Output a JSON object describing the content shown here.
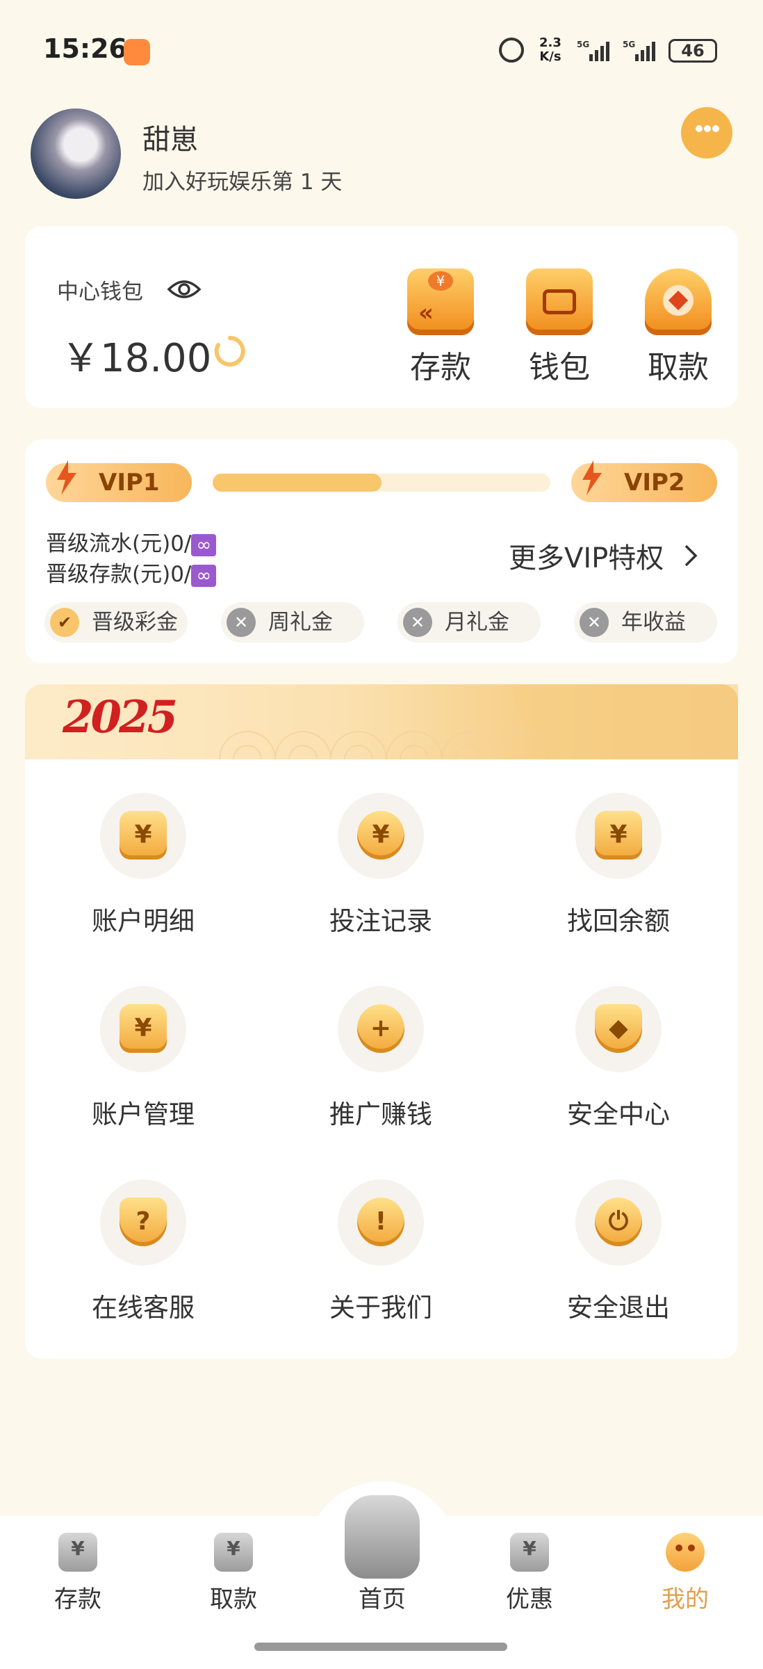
{
  "status_bar": {
    "time": "15:26",
    "net_speed": "2.3\nK/s",
    "battery": "46"
  },
  "profile": {
    "username": "甜崽",
    "join_text": "加入好玩娱乐第 1 天"
  },
  "wallet": {
    "label": "中心钱包",
    "balance": "￥18.00",
    "actions": [
      {
        "label": "存款"
      },
      {
        "label": "钱包"
      },
      {
        "label": "取款"
      }
    ]
  },
  "vip": {
    "current": "VIP1",
    "next": "VIP2",
    "progress": 0.5,
    "flow_req": "晋级流水(元)0/",
    "deposit_req": "晋级存款(元)0/",
    "infinity": "∞",
    "more_link": "更多VIP特权",
    "privileges": [
      {
        "label": "晋级彩金",
        "enabled": true
      },
      {
        "label": "周礼金",
        "enabled": false
      },
      {
        "label": "月礼金",
        "enabled": false
      },
      {
        "label": "年收益",
        "enabled": false
      }
    ]
  },
  "banner": {
    "year": "2025"
  },
  "menu": [
    {
      "label": "账户明细",
      "icon": "ledger-icon",
      "glyph": "¥"
    },
    {
      "label": "投注记录",
      "icon": "coin-icon",
      "glyph": "¥"
    },
    {
      "label": "找回余额",
      "icon": "search-yen-icon",
      "glyph": "¥"
    },
    {
      "label": "账户管理",
      "icon": "ledger-settings-icon",
      "glyph": "¥"
    },
    {
      "label": "推广赚钱",
      "icon": "add-user-icon",
      "glyph": "+"
    },
    {
      "label": "安全中心",
      "icon": "shield-icon",
      "glyph": "◆"
    },
    {
      "label": "在线客服",
      "icon": "question-icon",
      "glyph": "?"
    },
    {
      "label": "关于我们",
      "icon": "info-icon",
      "glyph": "!"
    },
    {
      "label": "安全退出",
      "icon": "power-icon",
      "glyph": "⏻"
    }
  ],
  "bottom_nav": [
    {
      "label": "存款",
      "glyph": "¥"
    },
    {
      "label": "取款",
      "glyph": "¥"
    },
    {
      "label": "首页",
      "glyph": ""
    },
    {
      "label": "优惠",
      "glyph": "¥"
    },
    {
      "label": "我的",
      "glyph": "••"
    }
  ],
  "colors": {
    "accent": "#f3a23a",
    "active_tab": "#e0a04c",
    "background": "#fdf8ec"
  }
}
